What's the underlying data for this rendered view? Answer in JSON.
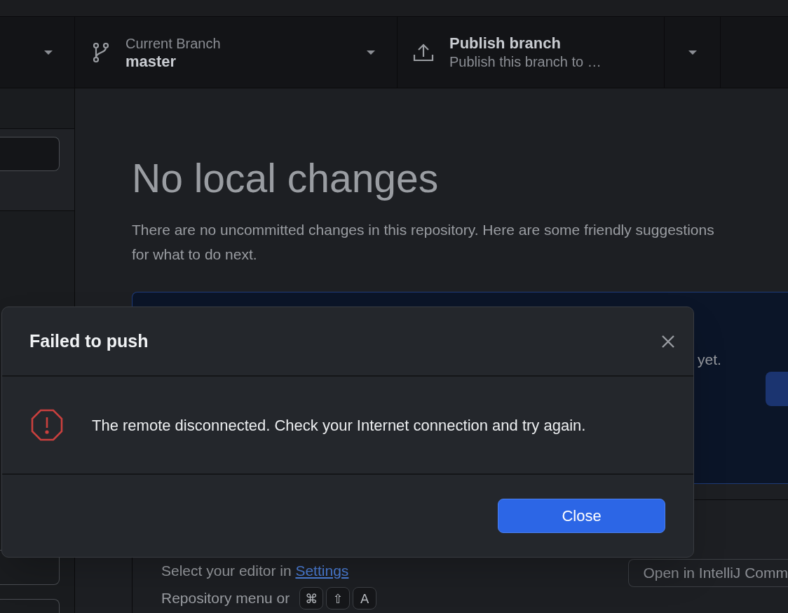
{
  "toolbar": {
    "branch": {
      "label": "Current Branch",
      "value": "master"
    },
    "publish": {
      "title": "Publish branch",
      "subtitle": "Publish this branch to …"
    }
  },
  "main": {
    "heading": "No local changes",
    "description": "There are no uncommitted changes in this repository. Here are some friendly suggestions for what to do next.",
    "publish_card": {
      "text": "yet."
    },
    "editor_card": {
      "text": "Select your editor in ",
      "link": "Settings",
      "button": "Open in IntelliJ Comm"
    },
    "shortcut": {
      "text": "Repository menu or",
      "keys": [
        "⌘",
        "⇧",
        "A"
      ]
    }
  },
  "dialog": {
    "title": "Failed to push",
    "message": "The remote disconnected. Check your Internet connection and try again.",
    "button": "Close"
  }
}
